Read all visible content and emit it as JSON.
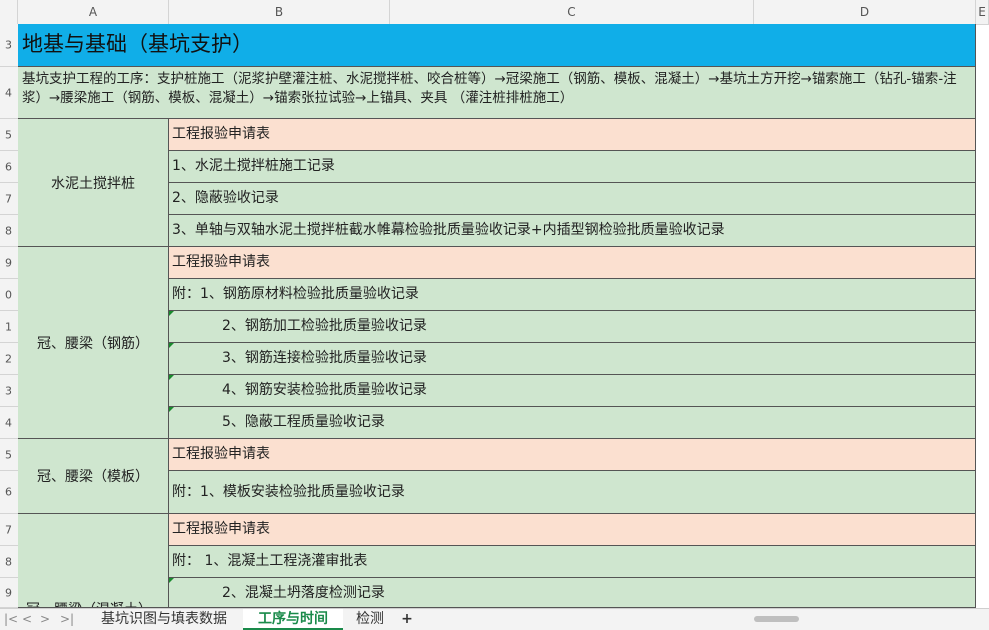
{
  "columns": [
    "A",
    "B",
    "C",
    "D",
    "E"
  ],
  "rows": [
    "3",
    "4",
    "5",
    "6",
    "7",
    "8",
    "9",
    "0",
    "1",
    "2",
    "3",
    "4",
    "5",
    "6",
    "7",
    "8",
    "9"
  ],
  "sheet": {
    "title": "地基与基础（基坑支护）",
    "description": "基坑支护工程的工序：支护桩施工（泥浆护壁灌注桩、水泥搅拌桩、咬合桩等）→冠梁施工（钢筋、模板、混凝土）→基坑土方开挖→锚索施工（钻孔-锚索-注浆）→腰梁施工（钢筋、模板、混凝土）→锚索张拉试验→上锚具、夹具 （灌注桩排桩施工）",
    "groups": [
      {
        "label": "水泥土搅拌桩",
        "items": [
          "工程报验申请表",
          "1、水泥土搅拌桩施工记录",
          "2、隐蔽验收记录",
          "3、单轴与双轴水泥土搅拌桩截水帷幕检验批质量验收记录+内插型钢检验批质量验收记录"
        ]
      },
      {
        "label": "冠、腰梁（钢筋）",
        "items": [
          "工程报验申请表",
          "附：1、钢筋原材料检验批质量验收记录",
          "2、钢筋加工检验批质量验收记录",
          "3、钢筋连接检验批质量验收记录",
          "4、钢筋安装检验批质量验收记录",
          "5、隐蔽工程质量验收记录"
        ]
      },
      {
        "label": "冠、腰梁（模板）",
        "items": [
          "工程报验申请表",
          "附：1、模板安装检验批质量验收记录"
        ]
      },
      {
        "label": "冠、腰梁（混凝土）",
        "items": [
          "工程报验申请表",
          "附：  1、混凝土工程浇灌审批表",
          "2、混凝土坍落度检测记录"
        ]
      }
    ]
  },
  "tabs": {
    "nav": [
      "|<",
      "<",
      ">",
      ">|"
    ],
    "sheets": [
      "基坑识图与填表数据",
      "工序与时间",
      "检测"
    ],
    "add": "+"
  },
  "colors": {
    "title_bg": "#10aee8",
    "green": "#cfe6cf",
    "peach": "#fbe0d0",
    "active_tab": "#1a8a4a"
  }
}
